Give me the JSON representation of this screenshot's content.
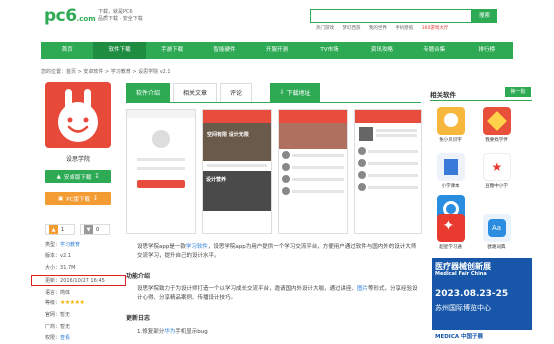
{
  "header": {
    "logo_text": "pc6",
    "logo_com": ".com",
    "tagline_line1": "下载，就是PC6",
    "tagline_line2": "品质下载 · 安全下载",
    "search_button": "搜索",
    "hot_links": [
      "热门游戏",
      "梦幻西游",
      "我的世界",
      "手机壁纸",
      "360游戏大厅"
    ]
  },
  "nav": {
    "items": [
      "首页",
      "软件下载",
      "手游下载",
      "智能硬件",
      "开服开测",
      "TV市场",
      "资讯攻略",
      "专题合集",
      "排行榜"
    ],
    "active_index": 1
  },
  "breadcrumb": "您的位置：首页 > 安卓软件 > 学习教育 > 设思学院 v2.1",
  "app": {
    "name": "设思学院",
    "android_download": "安卓版下载",
    "pc_download": "PC版下载",
    "likes": "1",
    "dislikes": "0",
    "info": [
      {
        "label": "类型：",
        "value": "学习教育",
        "link": true
      },
      {
        "label": "版本：",
        "value": "v2.1",
        "link": false
      },
      {
        "label": "大小：",
        "value": "31.7M",
        "link": false
      },
      {
        "label": "更新：",
        "value": "2016/10/27 16:45",
        "link": false
      },
      {
        "label": "语言：",
        "value": "简体",
        "link": false
      },
      {
        "label": "等级：",
        "value": "★★★★★",
        "link": false
      },
      {
        "label": "官网：",
        "value": "暂无",
        "link": false
      },
      {
        "label": "厂商：",
        "value": "暂无",
        "link": false
      },
      {
        "label": "权限：",
        "value": "查看",
        "link": true
      }
    ]
  },
  "tabs": [
    "软件介绍",
    "相关文章",
    "评论"
  ],
  "download_tab": "下载地址",
  "screens": {
    "s2_banner": "空间有限 设计无限",
    "s2_banner2": "设计营养"
  },
  "content": {
    "intro_pre": "设思学院app是一款",
    "intro_link": "学习软件",
    "intro_post": "，设思学院app为用户提供一个学习交流平台，方便用户通过软件与国内外的设计大师交流学习，提升自己的设计水平。",
    "func_title": "功能介绍",
    "func_pre": "设思学院致力于为设计师打造一个以学习成长交流平台，邀请国内外设计大咖，通过讲座、",
    "func_link": "图片",
    "func_post": "等形式，分享经验设计心得、分享精品案例、传播设计技巧。",
    "log_title": "更新日志",
    "log_pre": "1.修复部分",
    "log_link": "华为",
    "log_post": "手机显示bug"
  },
  "sidebar": {
    "title": "相关软件",
    "refresh": "换一批",
    "apps": [
      {
        "name": "免小贝识字",
        "color": "#f6b73c"
      },
      {
        "name": "我要找学伴",
        "color": "#e8503a"
      },
      {
        "name": "小学课本",
        "color": "#3a7ad8"
      },
      {
        "name": "每日英语听力",
        "color": "#2b8de0"
      },
      {
        "name": "豆糖中小学",
        "color": "#3bbf73"
      },
      {
        "name": "",
        "color": "#ffffff"
      },
      {
        "name": "超星学习通",
        "color": "#e83a2e"
      },
      {
        "name": "欧路词典",
        "color": "#2b8de0"
      }
    ]
  },
  "ad": {
    "title": "医疗器械创新展",
    "subtitle": "Medical Fair China",
    "date": "2023.08.23-25",
    "place": "苏州国际博览中心",
    "footer": "MEDICA 中国子展"
  }
}
